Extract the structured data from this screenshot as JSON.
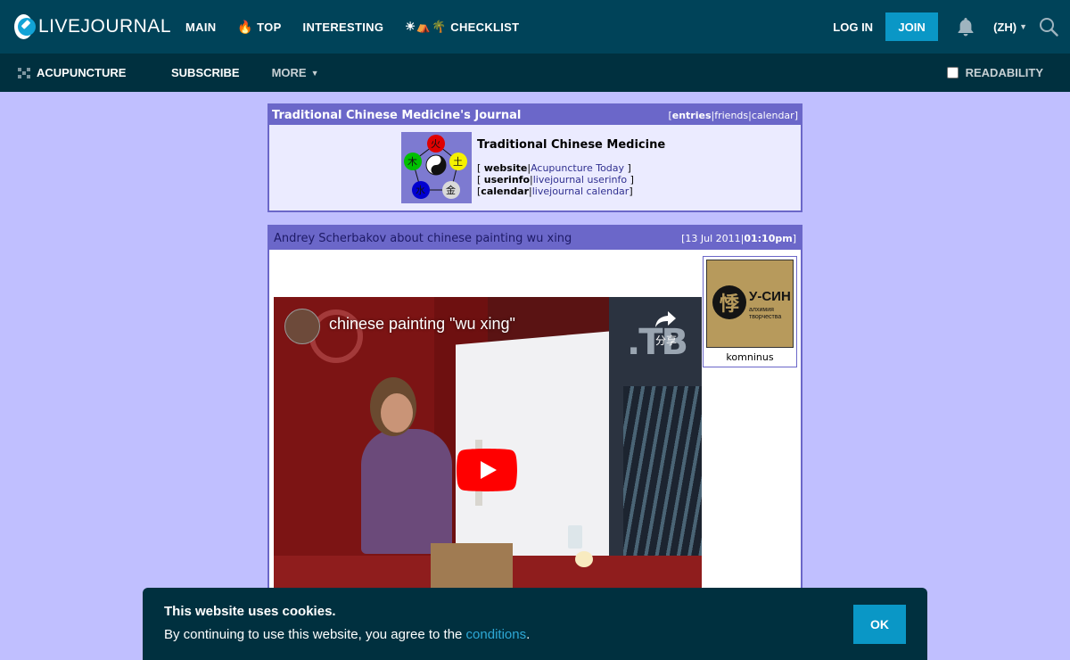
{
  "topbar": {
    "logo_text": "LIVEJOURNAL",
    "nav": {
      "main": "MAIN",
      "top_icon": "🔥",
      "top": "TOP",
      "interesting": "INTERESTING",
      "checklist_icons": "☀⛺🌴",
      "checklist": "CHECKLIST"
    },
    "login": "LOG IN",
    "join": "JOIN",
    "lang": "(ZH)",
    "icons": [
      "bell-icon",
      "search-icon",
      "chevron-down-icon"
    ]
  },
  "subbar": {
    "journal": "ACUPUNCTURE",
    "subscribe": "SUBSCRIBE",
    "more": "MORE",
    "readability": "READABILITY"
  },
  "journal_box": {
    "title": "Traditional Chinese Medicine's Journal",
    "links": {
      "open": "[",
      "entries": "entries",
      "sep1": "|",
      "friends": "friends",
      "sep2": "|",
      "calendar": "calendar",
      "close": "]"
    },
    "name": "Traditional Chinese Medicine",
    "rows": [
      {
        "pre": "[ ",
        "label": "website",
        "sep": "|",
        "link": "Acupuncture Today",
        "post": " ]"
      },
      {
        "pre": "[ ",
        "label": "userinfo",
        "sep": "|",
        "link": "livejournal userinfo",
        "post": " ]"
      },
      {
        "pre": "[",
        "label": "calendar",
        "sep": "|",
        "link": "livejournal calendar",
        "post": "]"
      }
    ],
    "elements": [
      "火",
      "土",
      "金",
      "水",
      "木"
    ]
  },
  "entry": {
    "subject": "Andrey Scherbakov about chinese painting wu xing",
    "date_open": "[",
    "date": "13 Jul 2011",
    "date_sep": "|",
    "time": "01:10pm",
    "date_close": "]",
    "video": {
      "title": "chinese painting \"wu xing\"",
      "share_label": "分享",
      "channel_logo": ".ТВ"
    },
    "userpic": {
      "glyph": "悸",
      "line1": "У-СИН",
      "line2": "алхимия",
      "line3": "творчества",
      "username": "komninus"
    }
  },
  "cookie": {
    "title": "This website uses cookies.",
    "text_before": "By continuing to use this website, you agree to the ",
    "link": "conditions",
    "text_after": ".",
    "ok": "OK"
  },
  "colors": {
    "topbar": "#004359",
    "subbar": "#00303f",
    "page_bg": "#c0bfff",
    "accent": "#0a97c6",
    "journal_header": "#6b67c9",
    "youtube_red": "#ff0000"
  }
}
